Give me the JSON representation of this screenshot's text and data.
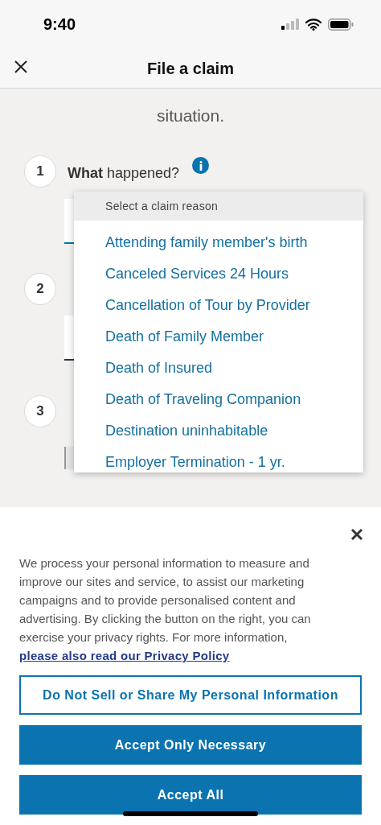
{
  "status_bar": {
    "time": "9:40"
  },
  "header": {
    "title": "File a claim"
  },
  "intro": {
    "text": "situation."
  },
  "steps": [
    {
      "number": "1",
      "label": "**What** happened?",
      "info": true,
      "kind": "open"
    },
    {
      "number": "2",
      "kind": "dark"
    },
    {
      "number": "3",
      "kind": "grey"
    }
  ],
  "dropdown": {
    "placeholder": "Select a claim reason",
    "options": [
      {
        "label": "Attending family member's birth",
        "selected": false
      },
      {
        "label": "Canceled Services 24 Hours",
        "selected": false
      },
      {
        "label": "Cancellation of Tour by Provider",
        "selected": false
      },
      {
        "label": "Death of Family Member",
        "selected": false
      },
      {
        "label": "Death of Insured",
        "selected": false
      },
      {
        "label": "Death of Traveling Companion",
        "selected": false
      },
      {
        "label": "Destination uninhabitable",
        "selected": false
      },
      {
        "label": "Employer Termination - 1 yr.",
        "selected": false
      }
    ]
  },
  "cookie_banner": {
    "text": "We process your personal information to measure and improve our sites and service, to assist our marketing campaigns and to provide personalised content and advertising. By clicking the button on the right, you can exercise your privacy rights. For more information, ",
    "link": "please also read our Privacy Policy",
    "buttons": [
      {
        "label": "Do Not Sell or Share My Personal Information",
        "kind": "outline"
      },
      {
        "label": "Accept Only Necessary",
        "kind": "filled"
      },
      {
        "label": "Accept All",
        "kind": "filled"
      }
    ]
  }
}
